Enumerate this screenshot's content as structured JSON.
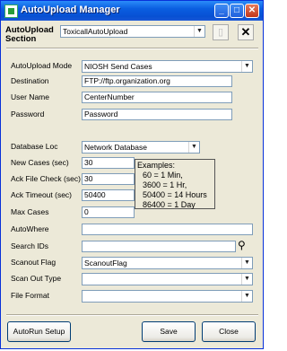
{
  "window": {
    "title": "AutoUpload Manager"
  },
  "header": {
    "section_label_1": "AutoUpload",
    "section_label_2": "Section",
    "section_value": "ToxicallAutoUpload",
    "new_icon": "blank-page-icon",
    "close_icon": "x-icon"
  },
  "form": {
    "mode_label": "AutoUpload Mode",
    "mode_value": "NIOSH Send Cases",
    "destination_label": "Destination",
    "destination_value": "FTP://ftp.organization.org",
    "username_label": "User Name",
    "username_value": "CenterNumber",
    "password_label": "Password",
    "password_value": "Password",
    "dbloc_label": "Database Loc",
    "dbloc_value": "Network Database",
    "newcases_label": "New Cases (sec)",
    "newcases_value": "30",
    "ackcheck_label": "Ack File Check (sec)",
    "ackcheck_value": "30",
    "acktimeout_label": "Ack Timeout (sec)",
    "acktimeout_value": "50400",
    "maxcases_label": "Max Cases",
    "maxcases_value": "0",
    "autowhere_label": "AutoWhere",
    "autowhere_value": "",
    "searchids_label": "Search IDs",
    "searchids_value": "",
    "scanoutflag_label": "Scanout Flag",
    "scanoutflag_value": "ScanoutFlag",
    "scanouttype_label": "Scan Out Type",
    "scanouttype_value": "",
    "fileformat_label": "File Format",
    "fileformat_value": ""
  },
  "examples": {
    "title": "Examples:",
    "lines": [
      "60 = 1 Min,",
      "3600 = 1 Hr,",
      "50400 = 14 Hours",
      "86400 = 1 Day"
    ]
  },
  "buttons": {
    "autorun": "AutoRun Setup",
    "save": "Save",
    "close": "Close"
  }
}
